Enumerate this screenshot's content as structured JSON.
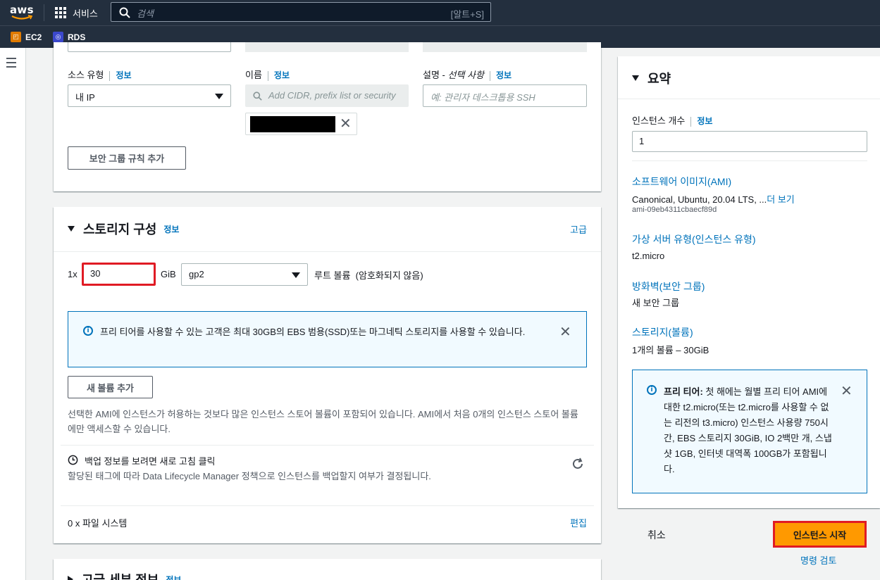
{
  "nav": {
    "logo": "aws",
    "services_label": "서비스",
    "search_placeholder": "검색",
    "search_shortcut": "[알트+S]",
    "favorites": [
      {
        "label": "EC2",
        "color": "#e07b00"
      },
      {
        "label": "RDS",
        "color": "#3b48cc"
      }
    ]
  },
  "rule": {
    "source_type_label": "소스 유형",
    "source_type_info": "정보",
    "source_type_value": "내 IP",
    "name_label": "이름",
    "name_info": "정보",
    "name_placeholder": "Add CIDR, prefix list or security",
    "desc_label": "설명 - ",
    "desc_label_optional": "선택 사항",
    "desc_info": "정보",
    "desc_placeholder": "예: 관리자 데스크톱용 SSH",
    "add_rule_button": "보안 그룹 규칙 추가"
  },
  "storage": {
    "title": "스토리지 구성",
    "info": "정보",
    "advanced_link": "고급",
    "prefix": "1x",
    "size_value": "30",
    "unit": "GiB",
    "volume_type": "gp2",
    "root_volume": "루트 볼륨  (암호화되지 않음)",
    "free_tier_alert": "프리 티어를 사용할 수 있는 고객은 최대 30GB의 EBS 범용(SSD)또는 마그네틱 스토리지를 사용할 수 있습니다.",
    "add_volume_button": "새 볼륨 추가",
    "instance_store_note": "선택한 AMI에 인스턴스가 허용하는 것보다 많은 인스턴스 스토어 볼륨이 포함되어 있습니다. AMI에서 처음 0개의 인스턴스 스토어 볼륨에만 액세스할 수 있습니다.",
    "backup_title": "백업 정보를 보려면 새로 고침 클릭",
    "backup_desc": "할당된 태그에 따라 Data Lifecycle Manager 정책으로 인스턴스를 백업할지 여부가 결정됩니다.",
    "file_systems": "0 x 파일 시스템",
    "edit_link": "편집"
  },
  "advanced": {
    "title": "고급 세부 정보",
    "info": "정보"
  },
  "summary": {
    "title": "요약",
    "instance_count_label": "인스턴스 개수",
    "instance_count_info": "정보",
    "instance_count_value": "1",
    "ami_label": "소프트웨어 이미지(AMI)",
    "ami_value": "Canonical, Ubuntu, 20.04 LTS, ...",
    "ami_more": "더 보기",
    "ami_id": "ami-09eb4311cbaecf89d",
    "instance_type_label": "가상 서버 유형(인스턴스 유형)",
    "instance_type_value": "t2.micro",
    "firewall_label": "방화벽(보안 그룹)",
    "firewall_value": "새 보안 그룹",
    "storage_label": "스토리지(볼륨)",
    "storage_value": "1개의 볼륨 – 30GiB",
    "free_tier_title": "프리 티어:",
    "free_tier_text": " 첫 해에는 월별 프리 티어 AMI에 대한 t2.micro(또는 t2.micro를 사용할 수 없는 리전의 t3.micro) 인스턴스 사용량 750시간, EBS 스토리지 30GiB, IO 2백만 개, 스냅샷 1GB, 인터넷 대역폭 100GB가 포함됩니다.",
    "cancel": "취소",
    "launch": "인스턴스 시작",
    "review_commands": "명령 검토"
  }
}
